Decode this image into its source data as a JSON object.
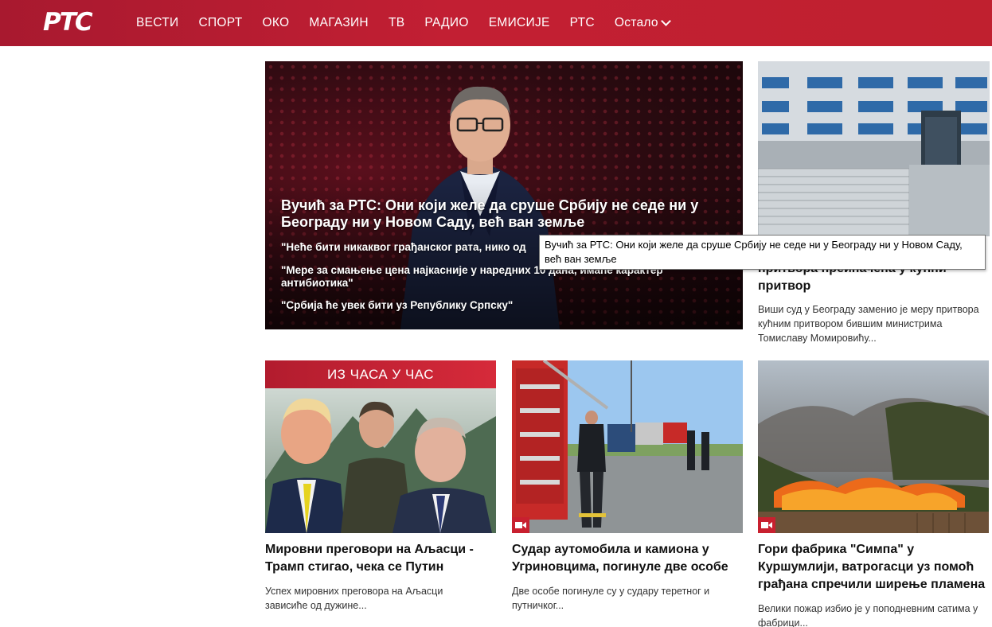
{
  "header": {
    "logo": "РТС",
    "nav": [
      "ВЕСТИ",
      "СПОРТ",
      "ОКО",
      "МАГАЗИН",
      "ТВ",
      "РАДИО",
      "ЕМИСИЈЕ",
      "РТС"
    ],
    "more": "Остало"
  },
  "hero": {
    "title": "Вучић за РТС: Они који желе да сруше Србију не седе ни у Београду ни у Новом Саду, већ ван земље",
    "bullets": [
      "\"Неће бити никаквог грађанског рата, нико од",
      "\"Мере за смањење цена најкасније у наредних 10 дана, имаће карактер антибиотика\"",
      "\"Србија ће увек бити уз Републику Српску\""
    ]
  },
  "tooltip": "Вучић за РТС: Они који желе да сруше Србију не седе ни у Београду ни у Новом Саду, већ ван земље",
  "side": {
    "title": "притвора преиначена у кућни притвор",
    "description": "Виши суд у Београду заменио је меру притвора кућним притвором бившим министрима Томиславу Момировићу..."
  },
  "cards": [
    {
      "banner": "ИЗ ЧАСА У ЧАС",
      "title": "Мировни преговори на Аљасци - Трамп стигао, чека се Путин",
      "description": "Успех мировних преговора на Аљасци зависиће од дужине..."
    },
    {
      "title": "Судар аутомобила и камиона у Угриновцима, погинуле две особе",
      "description": "Две особе погинуле су у судару теретног и путничког..."
    },
    {
      "title": "Гори фабрика \"Симпа\" у Куршумлији, ватрогасци уз помоћ грађана спречили ширење пламена",
      "description": "Велики пожар избио је у поподневним сатима у фабрици..."
    }
  ],
  "colors": {
    "brand": "#c21f33",
    "accent": "#c8202f"
  }
}
